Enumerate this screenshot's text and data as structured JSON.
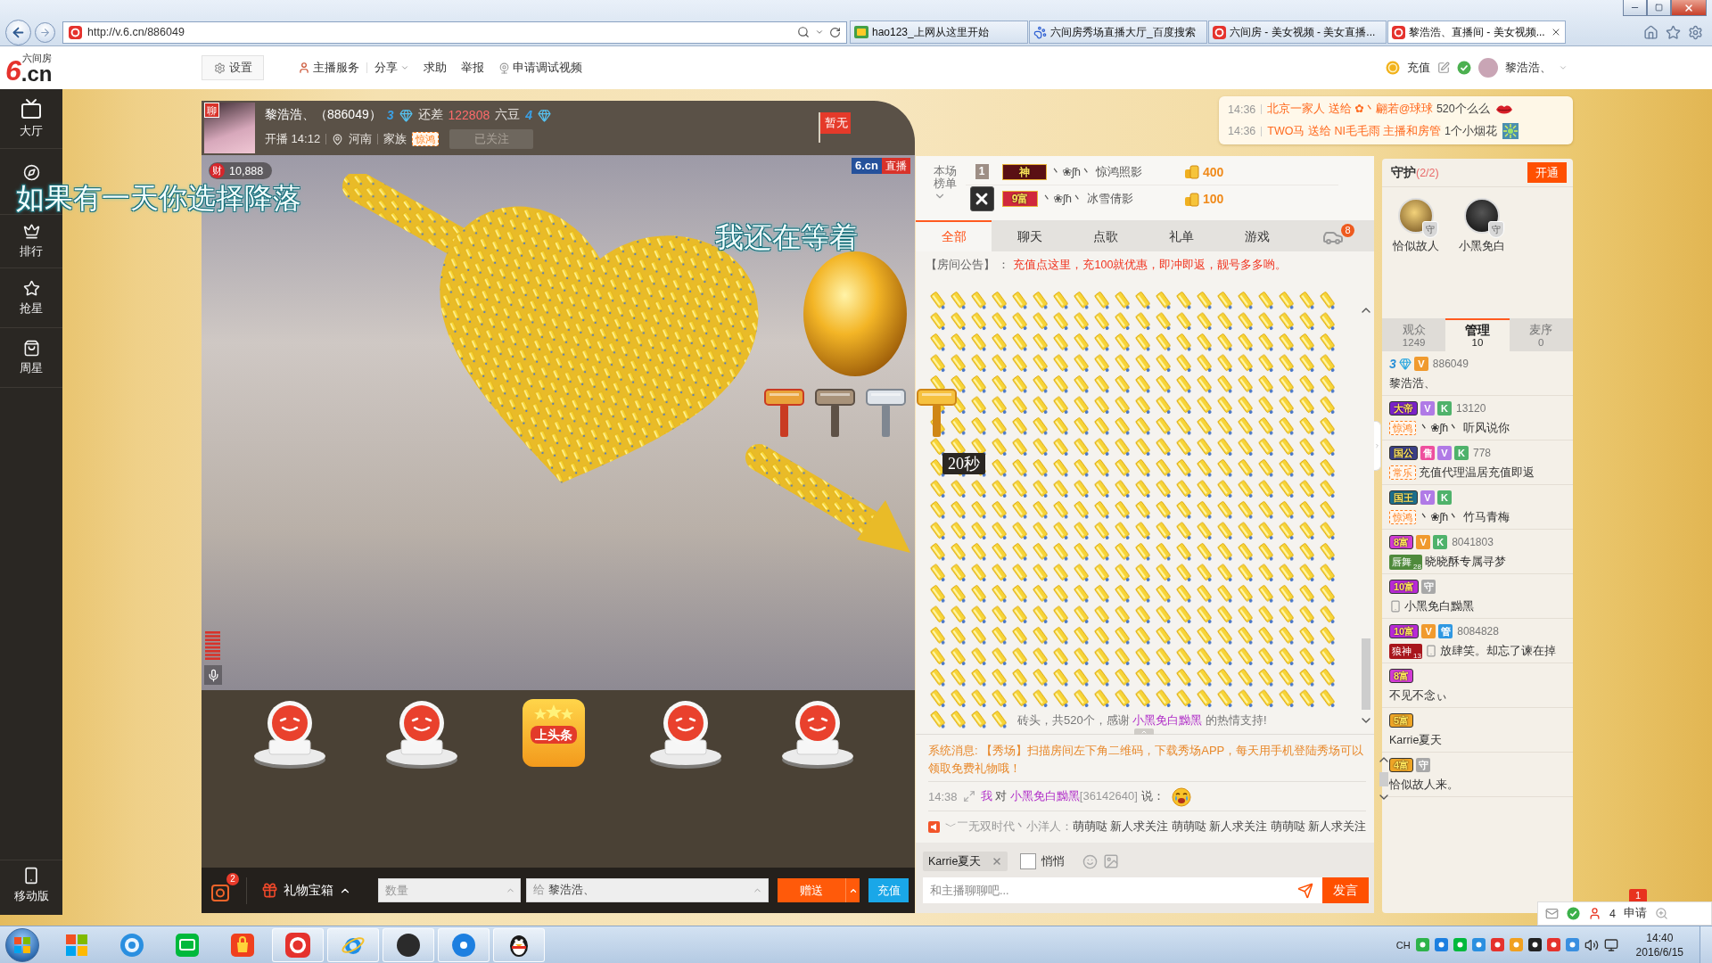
{
  "browser": {
    "address": "http://v.6.cn/886049",
    "tabs": [
      {
        "title": "hao123_上网从这里开始",
        "kind": "hao",
        "selected": false
      },
      {
        "title": "六间房秀场直播大厅_百度搜索",
        "kind": "paw",
        "selected": false
      },
      {
        "title": "六间房 - 美女视频 - 美女直播...",
        "kind": "six",
        "selected": false
      },
      {
        "title": "黎浩浩、直播间 - 美女视频...",
        "kind": "six",
        "selected": true
      }
    ]
  },
  "site_header": {
    "logo_mark": "6",
    "logo_domain": ".cn",
    "logo_name": "六间房",
    "settings": "设置",
    "nav": [
      {
        "label": "主播服务",
        "kind": "anchor"
      },
      {
        "label": "分享",
        "kind": "menu"
      },
      {
        "label": "求助",
        "kind": "plain"
      },
      {
        "label": "举报",
        "kind": "plain"
      },
      {
        "label": "申请调试视频",
        "kind": "camera"
      }
    ],
    "recharge": "充值",
    "user": "黎浩浩、"
  },
  "sidebar": {
    "items": [
      {
        "kind": "tv",
        "label": "大厅"
      },
      {
        "kind": "compass"
      },
      {
        "kind": "crown",
        "label": "排行"
      },
      {
        "kind": "star",
        "label": "抢星"
      },
      {
        "kind": "bag",
        "label": "周星"
      }
    ],
    "mobile": "移动版"
  },
  "lyrics": [
    "如果有一天你选择降落",
    "我还在等着"
  ],
  "anchor": {
    "chat_badge": "聊",
    "name": "黎浩浩、（886049）",
    "rank_now": "3",
    "gap_label": "还差",
    "gap_value": "122808",
    "gap_unit": "六豆",
    "rank_next": "4",
    "start": "开播 14:12",
    "location": "河南",
    "family_label": "家族",
    "family_tag": "惊鸿",
    "follow": "已关注",
    "followed": true,
    "flag": "暂无"
  },
  "video": {
    "wealth_icon": "财",
    "wealth": "10,888",
    "brand": "6.cn",
    "live": "直播",
    "countdown": "20秒",
    "hammers": [
      {
        "kind": "red"
      },
      {
        "kind": "bronze"
      },
      {
        "kind": "silver"
      },
      {
        "kind": "gold"
      }
    ]
  },
  "gifts": [
    {
      "kind": "face"
    },
    {
      "kind": "face"
    },
    {
      "kind": "headline",
      "label": "上头条"
    },
    {
      "kind": "face"
    },
    {
      "kind": "face"
    }
  ],
  "gift_bar": {
    "box_count": "2",
    "box_label": "礼物宝箱",
    "quantity_placeholder": "数量",
    "recipient_label": "给",
    "recipient": "黎浩浩、",
    "send": "赠送",
    "recharge": "充值"
  },
  "gift_feed": [
    {
      "time": "14:36",
      "sender": "北京一家人",
      "verb": "送给",
      "receiver": "✿丶翩若@球球",
      "gift": "520个么么",
      "kind": "lips"
    },
    {
      "time": "14:36",
      "sender": "TWO马",
      "verb": "送给",
      "receiver": "NI毛毛雨 主播和房管",
      "gift": "1个小烟花",
      "kind": "firework"
    }
  ],
  "rank": {
    "title": "本场榜单",
    "rows": [
      {
        "kind": "numbered",
        "place": "1",
        "badge": "神",
        "color": "#5a1014",
        "name": "丶❀ʃɦ丶 惊鸿照影",
        "amount": "400"
      },
      {
        "kind": "closable",
        "badge": "9富",
        "color": "#d0283c",
        "name": "丶❀ʃɦ丶 冰雪倩影",
        "amount": "100"
      }
    ]
  },
  "chat_tabs": [
    {
      "kind": "text",
      "label": "全部",
      "selected": true
    },
    {
      "kind": "text",
      "label": "聊天",
      "selected": false
    },
    {
      "kind": "text",
      "label": "点歌",
      "selected": false
    },
    {
      "kind": "text",
      "label": "礼单",
      "selected": false
    },
    {
      "kind": "text",
      "label": "游戏",
      "selected": false
    },
    {
      "kind": "car",
      "badge": "8",
      "selected": false
    }
  ],
  "notice": {
    "label": "【房间公告】 ：",
    "text": "充值点这里，充100就优惠，即冲即返，靓号多多哟。"
  },
  "gift_message": {
    "before": "砖头，共520个，感谢",
    "user": "小黑免白黝黑",
    "after": "的热情支持!"
  },
  "system_message": "系统消息: 【秀场】扫描房间左下角二维码，下载秀场APP，每天用手机登陆秀场可以领取免费礼物哦！",
  "chat_line": {
    "time": "14:38",
    "sender": "我",
    "verb": "对",
    "target": "小黑免白黝黑",
    "target_id": "[36142640]",
    "says": "说："
  },
  "broadcast": {
    "sender": "﹀￣无双时代丶小洋人：",
    "text": "萌萌哒 新人求关注 萌萌哒 新人求关注 萌萌哒 新人求关注"
  },
  "composer": {
    "target": "Karrie夏天",
    "whisper_label": "悄悄",
    "whisper": false,
    "placeholder": "和主播聊聊吧...",
    "send": "发言"
  },
  "guard": {
    "title": "守护",
    "count": "(2/2)",
    "open": "开通",
    "members": [
      {
        "name": "恰似故人",
        "kind": "gold",
        "badge": "守"
      },
      {
        "name": "小黑免白",
        "kind": "dark",
        "badge": "守"
      }
    ]
  },
  "audience_tabs": [
    {
      "label": "观众",
      "count": "1249",
      "selected": false
    },
    {
      "label": "管理",
      "count": "10",
      "selected": true
    },
    {
      "label": "麦序",
      "count": "0",
      "selected": false
    }
  ],
  "members": [
    {
      "badges": [
        {
          "kind": "diamond",
          "text": "3"
        },
        {
          "kind": "vip",
          "text": "V"
        }
      ],
      "id": "886049",
      "mobile": false,
      "name": "黎浩浩、"
    },
    {
      "badges": [
        {
          "kind": "title",
          "text": "大帝",
          "color": "#7a22c8"
        },
        {
          "kind": "svip",
          "text": "V"
        },
        {
          "kind": "k",
          "text": "K"
        }
      ],
      "id": "13120",
      "tag": {
        "kind": "family",
        "text": "惊鸿"
      },
      "mobile": false,
      "name": "丶❀ʃɦ丶 听风说你"
    },
    {
      "badges": [
        {
          "kind": "title",
          "text": "国公",
          "color": "#3b3f86"
        },
        {
          "kind": "seller",
          "text": "售"
        },
        {
          "kind": "svip",
          "text": "V"
        },
        {
          "kind": "k",
          "text": "K"
        }
      ],
      "id": "778",
      "tag": {
        "kind": "family",
        "text": "常乐"
      },
      "mobile": false,
      "name": "充值代理温居充值即返"
    },
    {
      "badges": [
        {
          "kind": "title",
          "text": "国王",
          "color": "#1d6f8e"
        },
        {
          "kind": "svip",
          "text": "V"
        },
        {
          "kind": "k",
          "text": "K"
        }
      ],
      "tag": {
        "kind": "family",
        "text": "惊鸿"
      },
      "mobile": false,
      "name": "丶❀ʃɦ丶 竹马青梅"
    },
    {
      "badges": [
        {
          "kind": "wealth",
          "text": "8富",
          "color": "#d23bd3"
        },
        {
          "kind": "vip",
          "text": "V"
        },
        {
          "kind": "k",
          "text": "K"
        }
      ],
      "id": "8041803",
      "tag": {
        "kind": "fan",
        "text": "唇舞",
        "num": "28",
        "color": "#4f8a3c"
      },
      "mobile": false,
      "name": "晓晓酥专属寻梦"
    },
    {
      "badges": [
        {
          "kind": "wealth",
          "text": "10富",
          "color": "#b82ad6"
        },
        {
          "kind": "guard",
          "text": "守"
        }
      ],
      "mobile": true,
      "name": "小黑免白黝黑"
    },
    {
      "badges": [
        {
          "kind": "wealth",
          "text": "10富",
          "color": "#b82ad6"
        },
        {
          "kind": "vip",
          "text": "V"
        },
        {
          "kind": "admin",
          "text": "管"
        }
      ],
      "id": "8084828",
      "tag": {
        "kind": "fan",
        "text": "狼神",
        "num": "13",
        "color": "#a8161c"
      },
      "mobile": true,
      "name": "放肆笑。却忘了谏在掉"
    },
    {
      "badges": [
        {
          "kind": "wealth",
          "text": "8富",
          "color": "#d23bd3"
        }
      ],
      "mobile": false,
      "name": "不见不念ぃ"
    },
    {
      "badges": [
        {
          "kind": "wealth",
          "text": "5富",
          "color": "#eea526"
        }
      ],
      "mobile": false,
      "name": "Karrie夏天"
    },
    {
      "badges": [
        {
          "kind": "wealth",
          "text": "4富",
          "color": "#eea526"
        },
        {
          "kind": "guard",
          "text": "守"
        }
      ],
      "mobile": false,
      "name": "恰似故人来。"
    }
  ],
  "mini_bar": {
    "notice_count": "1",
    "online": "4",
    "apply": "申请"
  },
  "taskbar": {
    "apps": [
      {
        "kind": "tiles",
        "running": false
      },
      {
        "kind": "globe",
        "running": false
      },
      {
        "kind": "tv",
        "running": false
      },
      {
        "kind": "bag",
        "running": false
      },
      {
        "kind": "six",
        "running": true
      },
      {
        "kind": "ie",
        "running": true
      },
      {
        "kind": "moon",
        "running": true
      },
      {
        "kind": "disc",
        "running": true
      },
      {
        "kind": "penguin",
        "running": true
      }
    ],
    "lang": "CH",
    "time": "14:40",
    "date": "2016/6/15"
  }
}
